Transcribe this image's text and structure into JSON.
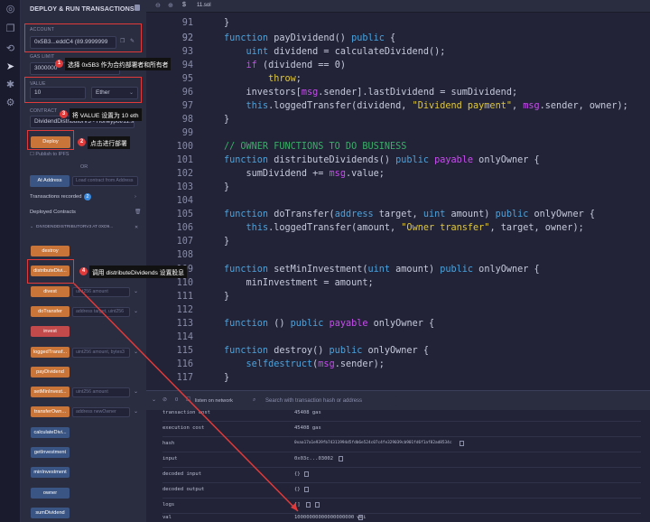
{
  "panel": {
    "title": "DEPLOY & RUN TRANSACTIONS",
    "account_label": "ACCOUNT",
    "account_value": "0x5B3...eddC4 (89.9999999",
    "gas_label": "GAS LIMIT",
    "gas_value": "3000000",
    "value_label": "VALUE",
    "value_amount": "10",
    "value_unit": "Ether",
    "contract_label": "CONTRACT",
    "contract_value": "DividendDistributorV3 - Honeypot/11.s",
    "deploy_label": "Deploy",
    "publish_label": "Publish to IPFS",
    "or_label": "OR",
    "at_address_label": "At Address",
    "load_contract_placeholder": "Load contract from Address",
    "transactions_label": "Transactions recorded",
    "transactions_count": "2",
    "deployed_label": "Deployed Contracts",
    "deployed_instance": "DIVIDENDDISTRIBUTORV3 AT 0XD9..."
  },
  "functions": [
    {
      "label": "destroy",
      "color": "orange",
      "arg": ""
    },
    {
      "label": "distributeDivi...",
      "color": "orange",
      "arg": ""
    },
    {
      "label": "divest",
      "color": "orange",
      "arg": "uint256 amount"
    },
    {
      "label": "doTransfer",
      "color": "orange",
      "arg": "address target, uint256"
    },
    {
      "label": "invest",
      "color": "red",
      "arg": ""
    },
    {
      "label": "loggedTransf...",
      "color": "orange",
      "arg": "uint256 amount, bytes3"
    },
    {
      "label": "payDividend",
      "color": "orange",
      "arg": ""
    },
    {
      "label": "setMinInvest...",
      "color": "orange",
      "arg": "uint256 amount"
    },
    {
      "label": "transferOwn...",
      "color": "orange",
      "arg": "address newOwner"
    },
    {
      "label": "calculateDivi...",
      "color": "blue",
      "arg": ""
    },
    {
      "label": "getInvestment",
      "color": "blue",
      "arg": ""
    },
    {
      "label": "minInvestment",
      "color": "blue",
      "arg": ""
    },
    {
      "label": "owner",
      "color": "blue",
      "arg": ""
    },
    {
      "label": "sumDividend",
      "color": "blue",
      "arg": ""
    }
  ],
  "annotations": {
    "n1": "1",
    "c1": "选择 0x5B3 作为合约部署者和所有者",
    "n2": "2",
    "c2": "点击进行部署",
    "n3": "3",
    "c3": "将 VALUE 设置为 10 eth",
    "n4": "4",
    "c4": "调用 distributeDividends 设置股息"
  },
  "editor": {
    "file_tab": "11.sol",
    "lines": [
      {
        "n": "91",
        "c": ""
      },
      {
        "n": "92",
        "c": ""
      },
      {
        "n": "93",
        "c": ""
      },
      {
        "n": "94",
        "c": ""
      },
      {
        "n": "95",
        "c": ""
      },
      {
        "n": "96",
        "c": ""
      },
      {
        "n": "97",
        "c": ""
      },
      {
        "n": "98",
        "c": ""
      },
      {
        "n": "99",
        "c": ""
      },
      {
        "n": "100",
        "c": ""
      },
      {
        "n": "101",
        "c": ""
      },
      {
        "n": "102",
        "c": ""
      },
      {
        "n": "103",
        "c": ""
      },
      {
        "n": "104",
        "c": ""
      },
      {
        "n": "105",
        "c": ""
      },
      {
        "n": "106",
        "c": ""
      },
      {
        "n": "107",
        "c": ""
      },
      {
        "n": "108",
        "c": ""
      },
      {
        "n": "109",
        "c": ""
      },
      {
        "n": "110",
        "c": ""
      },
      {
        "n": "111",
        "c": ""
      },
      {
        "n": "112",
        "c": ""
      },
      {
        "n": "113",
        "c": ""
      },
      {
        "n": "114",
        "c": ""
      },
      {
        "n": "115",
        "c": ""
      },
      {
        "n": "116",
        "c": ""
      },
      {
        "n": "117",
        "c": ""
      }
    ]
  },
  "terminal": {
    "listen_label": "listen on network",
    "search_placeholder": "Search with transaction hash or address",
    "rows": [
      {
        "k": "transaction cost",
        "v": "45408 gas"
      },
      {
        "k": "execution cost",
        "v": "45408 gas"
      },
      {
        "k": "hash",
        "v": "0xaa17a1e939fb74311994d5fdb6e524c07c4fe329039cb901fd6f1af82ad8534c"
      },
      {
        "k": "input",
        "v": "0x03c...03002"
      },
      {
        "k": "decoded input",
        "v": "{}"
      },
      {
        "k": "decoded output",
        "v": "{}"
      },
      {
        "k": "logs",
        "v": "[]"
      },
      {
        "k": "val",
        "v": "10000000000000000000 wei"
      }
    ]
  }
}
